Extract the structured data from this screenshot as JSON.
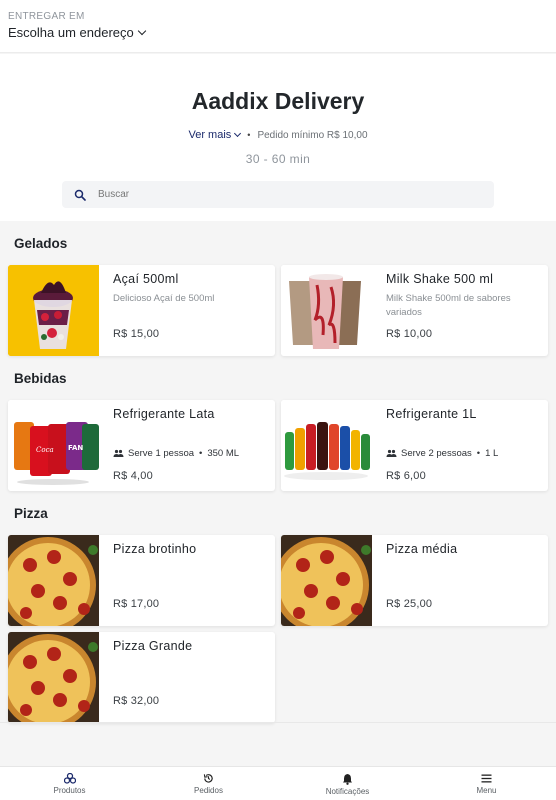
{
  "header": {
    "deliver_label": "ENTREGAR EM",
    "address_label": "Escolha um endereço"
  },
  "store": {
    "name": "Aaddix Delivery",
    "more_label": "Ver mais",
    "min_order": "Pedido mínimo R$ 10,00",
    "delivery_time": "30 - 60 min"
  },
  "search": {
    "placeholder": "Buscar"
  },
  "sections": [
    {
      "title": "Gelados",
      "items": [
        {
          "name": "Açaí 500ml",
          "description": "Delicioso Açaí de 500ml",
          "price": "R$ 15,00",
          "image": "acai-cup"
        },
        {
          "name": "Milk Shake 500 ml",
          "description": "Milk Shake 500ml de sabores variados",
          "price": "R$ 10,00",
          "image": "milkshake-cups"
        }
      ]
    },
    {
      "title": "Bebidas",
      "items": [
        {
          "name": "Refrigerante Lata",
          "serves": "Serve 1 pessoa",
          "size": "350 ML",
          "price": "R$ 4,00",
          "image": "soda-cans"
        },
        {
          "name": "Refrigerante 1L",
          "serves": "Serve 2 pessoas",
          "size": "1 L",
          "price": "R$ 6,00",
          "image": "soda-bottles"
        }
      ]
    },
    {
      "title": "Pizza",
      "items": [
        {
          "name": "Pizza brotinho",
          "price": "R$ 17,00",
          "image": "pepperoni-pizza"
        },
        {
          "name": "Pizza média",
          "price": "R$ 25,00",
          "image": "pepperoni-pizza"
        },
        {
          "name": "Pizza Grande",
          "price": "R$ 32,00",
          "image": "pepperoni-pizza"
        }
      ]
    }
  ],
  "nav": {
    "products": "Produtos",
    "orders": "Pedidos",
    "notifications": "Notificações",
    "menu": "Menu"
  },
  "colors": {
    "accent": "#1b2a6b",
    "acai_bg": "#f5b800",
    "page_bg": "#f5f5f5"
  }
}
